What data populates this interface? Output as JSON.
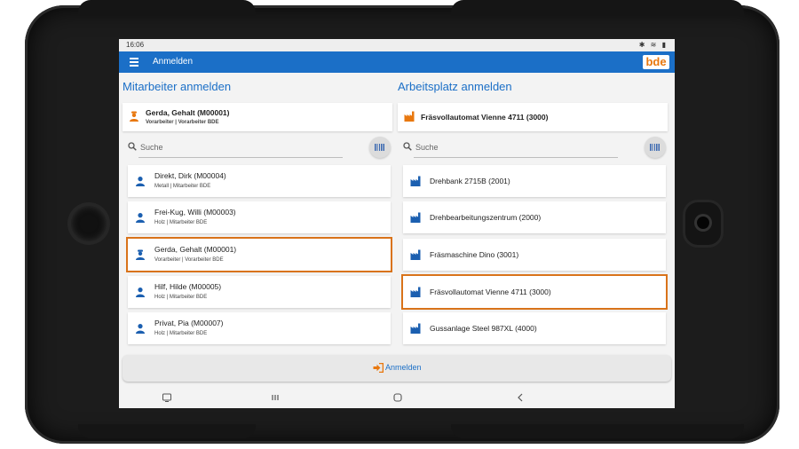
{
  "status_bar": {
    "time": "16:06",
    "icons": "✱ ≋ ▮"
  },
  "app_bar": {
    "title": "Anmelden",
    "logo": "bde"
  },
  "employees": {
    "heading": "Mitarbeiter anmelden",
    "selected": {
      "name": "Gerda, Gehalt (M00001)",
      "sub": "Vorarbeiter | Vorarbeiter BDE"
    },
    "search_placeholder": "Suche",
    "items": [
      {
        "name": "Direkt, Dirk (M00004)",
        "sub": "Metall | Mitarbeiter BDE"
      },
      {
        "name": "Frei-Kug, Willi (M00003)",
        "sub": "Holz | Mitarbeiter BDE"
      },
      {
        "name": "Gerda, Gehalt (M00001)",
        "sub": "Vorarbeiter | Vorarbeiter BDE"
      },
      {
        "name": "Hilf, Hilde (M00005)",
        "sub": "Holz | Mitarbeiter BDE"
      },
      {
        "name": "Privat, Pia (M00007)",
        "sub": "Holz | Mitarbeiter BDE"
      }
    ]
  },
  "workstations": {
    "heading": "Arbeitsplatz anmelden",
    "selected": {
      "name": "Fräsvollautomat Vienne 4711 (3000)"
    },
    "search_placeholder": "Suche",
    "items": [
      {
        "name": "Drehbank 2715B (2001)"
      },
      {
        "name": "Drehbearbeitungszentrum (2000)"
      },
      {
        "name": "Fräsmaschine Dino (3001)"
      },
      {
        "name": "Fräsvollautomat Vienne 4711 (3000)"
      },
      {
        "name": "Gussanlage Steel 987XL (4000)"
      }
    ]
  },
  "login_button": {
    "label": "Anmelden"
  },
  "colors": {
    "primary": "#1b6fc7",
    "accent": "#e8780f",
    "highlight": "#d9731a"
  }
}
